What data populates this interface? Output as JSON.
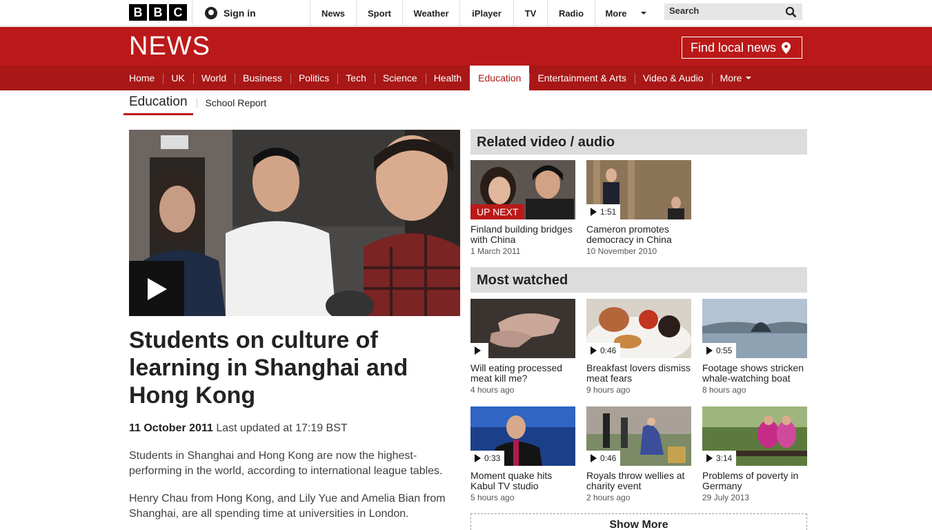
{
  "topbar": {
    "logo_letters": [
      "B",
      "B",
      "C"
    ],
    "signin_label": "Sign in",
    "nav": [
      "News",
      "Sport",
      "Weather",
      "iPlayer",
      "TV",
      "Radio",
      "More"
    ],
    "search_placeholder": "Search"
  },
  "header": {
    "brand": "NEWS",
    "local_news_label": "Find local news"
  },
  "section_nav": {
    "items": [
      "Home",
      "UK",
      "World",
      "Business",
      "Politics",
      "Tech",
      "Science",
      "Health",
      "Education",
      "Entertainment & Arts",
      "Video & Audio",
      "More"
    ],
    "active": "Education"
  },
  "sub_nav": {
    "current": "Education",
    "link": "School Report"
  },
  "story": {
    "headline": "Students on culture of learning in Shanghai and Hong Kong",
    "date": "11 October 2011",
    "updated": "Last updated at 17:19 BST",
    "paragraphs": [
      "Students in Shanghai and Hong Kong are now the highest-performing in the world, according to international league tables.",
      "Henry Chau from Hong Kong, and Lily Yue and Amelia Bian from Shanghai, are all spending time at universities in London."
    ]
  },
  "related": {
    "title": "Related video / audio",
    "items": [
      {
        "badge": "UP NEXT",
        "title": "Finland building bridges with China",
        "time": "1 March 2011"
      },
      {
        "badge": "1:51",
        "title": "Cameron promotes democracy in China",
        "time": "10 November 2010"
      }
    ]
  },
  "most_watched": {
    "title": "Most watched",
    "items": [
      {
        "badge": "",
        "title": "Will eating processed meat kill me?",
        "time": "4 hours ago"
      },
      {
        "badge": "0:46",
        "title": "Breakfast lovers dismiss meat fears",
        "time": "9 hours ago"
      },
      {
        "badge": "0:55",
        "title": "Footage shows stricken whale-watching boat",
        "time": "8 hours ago"
      },
      {
        "badge": "0:33",
        "title": "Moment quake hits Kabul TV studio",
        "time": "5 hours ago"
      },
      {
        "badge": "0:46",
        "title": "Royals throw wellies at charity event",
        "time": "2 hours ago"
      },
      {
        "badge": "3:14",
        "title": "Problems of poverty in Germany",
        "time": "29 July 2013"
      }
    ],
    "show_more_label": "Show More"
  },
  "colors": {
    "bbc_red": "#bb1919",
    "nav_red": "#a91717",
    "panel_grey": "#dcdcdc"
  }
}
